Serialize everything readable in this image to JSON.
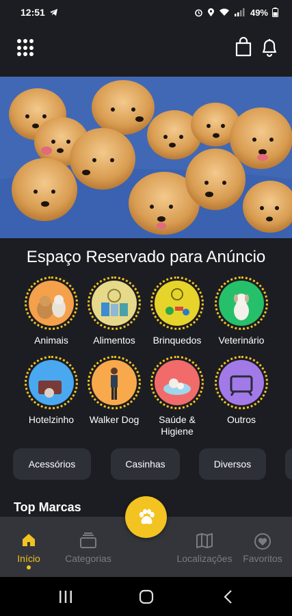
{
  "status": {
    "time": "12:51",
    "battery": "49%"
  },
  "ad_text": "Espaço Reservado para Anúncio",
  "categories": [
    {
      "label": "Animais",
      "color": "#f5a04a"
    },
    {
      "label": "Alimentos",
      "color": "#e7d98a"
    },
    {
      "label": "Brinquedos",
      "color": "#e6d42b"
    },
    {
      "label": "Veterinário",
      "color": "#26c06a"
    },
    {
      "label": "Hotelzinho",
      "color": "#4aa8f0"
    },
    {
      "label": "Walker Dog",
      "color": "#f7a94b"
    },
    {
      "label": "Saúde & Higiene",
      "color": "#f26b6b"
    },
    {
      "label": "Outros",
      "color": "#a27ae8"
    }
  ],
  "chips": [
    "Acessórios",
    "Casinhas",
    "Diversos"
  ],
  "top_brands_title": "Top Marcas",
  "nav": {
    "home": "Início",
    "categories": "Categorias",
    "locations": "Localizações",
    "favorites": "Favoritos"
  },
  "colors": {
    "accent": "#f2c321",
    "background": "#1c1d22",
    "nav_bg": "#34353b"
  }
}
